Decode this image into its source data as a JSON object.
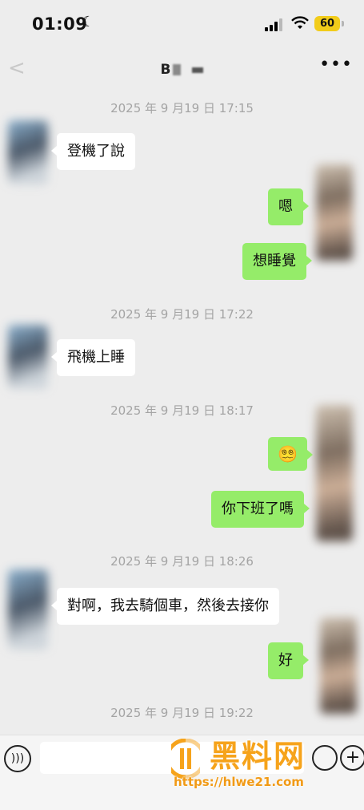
{
  "status_bar": {
    "time": "01:09",
    "battery": "60"
  },
  "header": {
    "contact_name_visible": "B",
    "back_icon": "chevron-left-icon",
    "more_icon": "more-dots-icon"
  },
  "messages": [
    {
      "type": "timestamp",
      "text": "2025 年 9 月19 日 17:15"
    },
    {
      "type": "incoming",
      "text": "登機了說"
    },
    {
      "type": "outgoing",
      "text": "嗯"
    },
    {
      "type": "outgoing",
      "text": "想睡覺"
    },
    {
      "type": "timestamp",
      "text": "2025 年 9 月19 日 17:22"
    },
    {
      "type": "incoming",
      "text": "飛機上睡"
    },
    {
      "type": "timestamp",
      "text": "2025 年 9 月19 日 18:17"
    },
    {
      "type": "outgoing",
      "text": "😵‍💫"
    },
    {
      "type": "outgoing",
      "text": "你下班了嗎"
    },
    {
      "type": "timestamp",
      "text": "2025 年 9 月19 日 18:26"
    },
    {
      "type": "incoming",
      "text": "對啊，我去騎個車，然後去接你"
    },
    {
      "type": "outgoing",
      "text": "好"
    },
    {
      "type": "timestamp",
      "text": "2025 年 9 月19 日 19:22"
    }
  ],
  "input_bar": {
    "value": "",
    "placeholder": ""
  },
  "watermark": {
    "title": "黑料网",
    "url": "https://hlwe21.com"
  },
  "colors": {
    "outgoing_bubble": "#95ec69",
    "incoming_bubble": "#ffffff",
    "background": "#ededed",
    "watermark": "#f6a31b"
  }
}
